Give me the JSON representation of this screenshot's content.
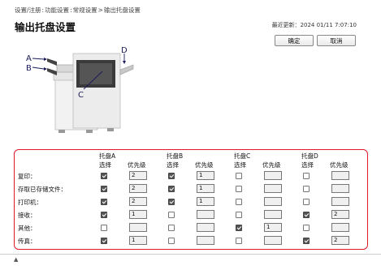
{
  "breadcrumb": {
    "items": [
      "设置/注册",
      "功能设置",
      "常规设置",
      "输出托盘设置"
    ],
    "separators": [
      ":",
      ":",
      ">"
    ]
  },
  "page": {
    "title": "输出托盘设置",
    "last_update_label": "最近更新：",
    "last_update_value": "2024 01/11 7:07:10"
  },
  "buttons": {
    "ok": "确定",
    "cancel": "取消"
  },
  "diagram": {
    "labels": [
      "A",
      "B",
      "C",
      "D"
    ]
  },
  "trays": [
    {
      "name": "托盘A",
      "select": "选择",
      "priority": "优先级"
    },
    {
      "name": "托盘B",
      "select": "选择",
      "priority": "优先级"
    },
    {
      "name": "托盘C",
      "select": "选择",
      "priority": "优先级"
    },
    {
      "name": "托盘D",
      "select": "选择",
      "priority": "优先级"
    }
  ],
  "rows": [
    {
      "label": "复印：",
      "cells": [
        {
          "checked": true,
          "priority": "2"
        },
        {
          "checked": true,
          "priority": "1"
        },
        {
          "checked": false,
          "priority": ""
        },
        {
          "checked": false,
          "priority": ""
        }
      ]
    },
    {
      "label": "存取已存储文件：",
      "cells": [
        {
          "checked": true,
          "priority": "2"
        },
        {
          "checked": true,
          "priority": "1"
        },
        {
          "checked": false,
          "priority": ""
        },
        {
          "checked": false,
          "priority": ""
        }
      ]
    },
    {
      "label": "打印机：",
      "cells": [
        {
          "checked": true,
          "priority": "2"
        },
        {
          "checked": true,
          "priority": "1"
        },
        {
          "checked": false,
          "priority": ""
        },
        {
          "checked": false,
          "priority": ""
        }
      ]
    },
    {
      "label": "接收：",
      "cells": [
        {
          "checked": true,
          "priority": "1"
        },
        {
          "checked": false,
          "priority": ""
        },
        {
          "checked": false,
          "priority": ""
        },
        {
          "checked": true,
          "priority": "2"
        }
      ]
    },
    {
      "label": "其他：",
      "cells": [
        {
          "checked": false,
          "priority": ""
        },
        {
          "checked": false,
          "priority": ""
        },
        {
          "checked": true,
          "priority": "1"
        },
        {
          "checked": false,
          "priority": ""
        }
      ]
    },
    {
      "label": "传真：",
      "cells": [
        {
          "checked": true,
          "priority": "1"
        },
        {
          "checked": false,
          "priority": ""
        },
        {
          "checked": false,
          "priority": ""
        },
        {
          "checked": true,
          "priority": "2"
        }
      ]
    }
  ],
  "footer": {
    "scroll_mark": "▲"
  },
  "colors": {
    "highlight": "#e0192a",
    "checked": "#555555"
  }
}
